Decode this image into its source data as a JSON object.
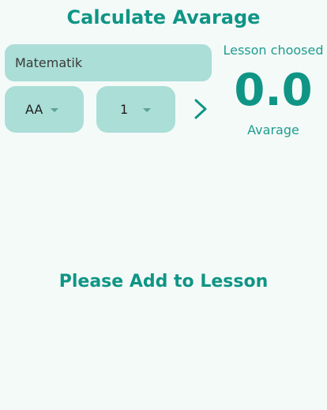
{
  "header": {
    "title": "Calculate Avarage"
  },
  "form": {
    "lesson_value": "Matematik",
    "grade_value": "AA",
    "credit_value": "1",
    "next_icon": "chevron-right-icon",
    "dropdown_icon": "caret-down-icon"
  },
  "summary": {
    "lesson_label": "Lesson choosed",
    "average_value": "0.0",
    "average_label": "Avarage"
  },
  "list": {
    "empty_message": "Please Add to Lesson"
  },
  "colors": {
    "background": "#f4faf8",
    "primary": "#0f9585",
    "field_fill": "#aaded7"
  }
}
